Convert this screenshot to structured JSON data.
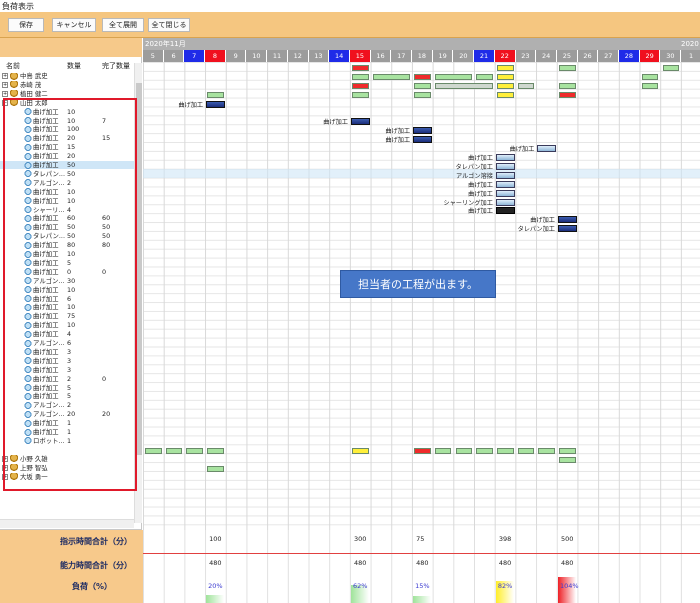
{
  "window_title": "負荷表示",
  "toolbar": {
    "save": "保存",
    "cancel": "キャンセル",
    "expand_all": "全て展開",
    "collapse_all": "全て閉じる"
  },
  "tree_header": {
    "name": "名前",
    "qty": "数量",
    "done_qty": "完了数量"
  },
  "tree_rows": [
    {
      "name": "中島 武史",
      "type": "person",
      "expander": "+",
      "qty": "",
      "done": ""
    },
    {
      "name": "赤崎 茂",
      "type": "person",
      "expander": "+",
      "qty": "",
      "done": ""
    },
    {
      "name": "植田 健二",
      "type": "person",
      "expander": "+",
      "qty": "",
      "done": ""
    },
    {
      "name": "山田 太郎",
      "type": "person",
      "expander": "−",
      "qty": "",
      "done": ""
    },
    {
      "name": "曲げ加工",
      "type": "task",
      "qty": "10",
      "done": ""
    },
    {
      "name": "曲げ加工",
      "type": "task",
      "qty": "10",
      "done": "7"
    },
    {
      "name": "曲げ加工",
      "type": "task",
      "qty": "100",
      "done": ""
    },
    {
      "name": "曲げ加工",
      "type": "task",
      "qty": "20",
      "done": "15"
    },
    {
      "name": "曲げ加工",
      "type": "task",
      "qty": "15",
      "done": ""
    },
    {
      "name": "曲げ加工",
      "type": "task",
      "qty": "20",
      "done": ""
    },
    {
      "name": "曲げ加工",
      "type": "task",
      "qty": "50",
      "done": "",
      "selected": true
    },
    {
      "name": "タレパン...",
      "type": "task",
      "qty": "50",
      "done": ""
    },
    {
      "name": "アルゴン...",
      "type": "task",
      "qty": "2",
      "done": ""
    },
    {
      "name": "曲げ加工",
      "type": "task",
      "qty": "10",
      "done": ""
    },
    {
      "name": "曲げ加工",
      "type": "task",
      "qty": "10",
      "done": ""
    },
    {
      "name": "シャーリ...",
      "type": "task",
      "qty": "4",
      "done": ""
    },
    {
      "name": "曲げ加工",
      "type": "task",
      "qty": "60",
      "done": "60"
    },
    {
      "name": "曲げ加工",
      "type": "task",
      "qty": "50",
      "done": "50"
    },
    {
      "name": "タレパン...",
      "type": "task",
      "qty": "50",
      "done": "50"
    },
    {
      "name": "曲げ加工",
      "type": "task",
      "qty": "80",
      "done": "80"
    },
    {
      "name": "曲げ加工",
      "type": "task",
      "qty": "10",
      "done": ""
    },
    {
      "name": "曲げ加工",
      "type": "task",
      "qty": "5",
      "done": ""
    },
    {
      "name": "曲げ加工",
      "type": "task",
      "qty": "0",
      "done": "0"
    },
    {
      "name": "アルゴン...",
      "type": "task",
      "qty": "30",
      "done": ""
    },
    {
      "name": "曲げ加工",
      "type": "task",
      "qty": "10",
      "done": ""
    },
    {
      "name": "曲げ加工",
      "type": "task",
      "qty": "6",
      "done": ""
    },
    {
      "name": "曲げ加工",
      "type": "task",
      "qty": "10",
      "done": ""
    },
    {
      "name": "曲げ加工",
      "type": "task",
      "qty": "75",
      "done": ""
    },
    {
      "name": "曲げ加工",
      "type": "task",
      "qty": "10",
      "done": ""
    },
    {
      "name": "曲げ加工",
      "type": "task",
      "qty": "4",
      "done": ""
    },
    {
      "name": "アルゴン...",
      "type": "task",
      "qty": "6",
      "done": ""
    },
    {
      "name": "曲げ加工",
      "type": "task",
      "qty": "3",
      "done": ""
    },
    {
      "name": "曲げ加工",
      "type": "task",
      "qty": "3",
      "done": ""
    },
    {
      "name": "曲げ加工",
      "type": "task",
      "qty": "3",
      "done": ""
    },
    {
      "name": "曲げ加工",
      "type": "task",
      "qty": "2",
      "done": "0"
    },
    {
      "name": "曲げ加工",
      "type": "task",
      "qty": "5",
      "done": ""
    },
    {
      "name": "曲げ加工",
      "type": "task",
      "qty": "5",
      "done": ""
    },
    {
      "name": "アルゴン...",
      "type": "task",
      "qty": "2",
      "done": ""
    },
    {
      "name": "アルゴン...",
      "type": "task",
      "qty": "20",
      "done": "20"
    },
    {
      "name": "曲げ加工",
      "type": "task",
      "qty": "1",
      "done": ""
    },
    {
      "name": "曲げ加工",
      "type": "task",
      "qty": "1",
      "done": ""
    },
    {
      "name": "ロボット...",
      "type": "task",
      "qty": "1",
      "done": ""
    },
    {
      "name": "",
      "type": "blank",
      "qty": "",
      "done": ""
    },
    {
      "name": "小野 久雄",
      "type": "person",
      "expander": "+",
      "qty": "",
      "done": ""
    },
    {
      "name": "上野 智弘",
      "type": "person",
      "expander": "+",
      "qty": "",
      "done": ""
    },
    {
      "name": "大坂 勇一",
      "type": "person",
      "expander": "+",
      "qty": "",
      "done": ""
    }
  ],
  "calendar": {
    "month_label": "2020年11月",
    "next_month_label": "2020",
    "days": [
      {
        "d": "5",
        "kind": "normal"
      },
      {
        "d": "6",
        "kind": "normal"
      },
      {
        "d": "7",
        "kind": "sat"
      },
      {
        "d": "8",
        "kind": "sun"
      },
      {
        "d": "9",
        "kind": "normal"
      },
      {
        "d": "10",
        "kind": "normal"
      },
      {
        "d": "11",
        "kind": "normal"
      },
      {
        "d": "12",
        "kind": "normal"
      },
      {
        "d": "13",
        "kind": "normal"
      },
      {
        "d": "14",
        "kind": "sat"
      },
      {
        "d": "15",
        "kind": "sun"
      },
      {
        "d": "16",
        "kind": "normal"
      },
      {
        "d": "17",
        "kind": "normal"
      },
      {
        "d": "18",
        "kind": "normal"
      },
      {
        "d": "19",
        "kind": "normal"
      },
      {
        "d": "20",
        "kind": "normal"
      },
      {
        "d": "21",
        "kind": "sat"
      },
      {
        "d": "22",
        "kind": "sun"
      },
      {
        "d": "23",
        "kind": "normal"
      },
      {
        "d": "24",
        "kind": "normal"
      },
      {
        "d": "25",
        "kind": "normal"
      },
      {
        "d": "26",
        "kind": "normal"
      },
      {
        "d": "27",
        "kind": "normal"
      },
      {
        "d": "28",
        "kind": "sat"
      },
      {
        "d": "29",
        "kind": "sun"
      },
      {
        "d": "30",
        "kind": "normal"
      },
      {
        "d": "1",
        "kind": "normal"
      }
    ],
    "colors": {
      "sat": "#1f2be8",
      "sun": "#f0101e",
      "normal": "#9c9c9c"
    }
  },
  "task_labels": [
    {
      "text": "曲げ加工",
      "row": 5,
      "col": 3
    },
    {
      "text": "曲げ加工",
      "row": 7,
      "col": 10
    },
    {
      "text": "曲げ加工",
      "row": 8,
      "col": 13
    },
    {
      "text": "曲げ加工",
      "row": 9,
      "col": 13
    },
    {
      "text": "曲げ加工",
      "row": 10,
      "col": 19
    },
    {
      "text": "曲げ加工",
      "row": 11,
      "col": 17
    },
    {
      "text": "タレパン加工",
      "row": 12,
      "col": 17
    },
    {
      "text": "アルゴン溶接",
      "row": 13,
      "col": 17
    },
    {
      "text": "曲げ加工",
      "row": 14,
      "col": 17
    },
    {
      "text": "曲げ加工",
      "row": 15,
      "col": 17
    },
    {
      "text": "シャーリング加工",
      "row": 16,
      "col": 17
    },
    {
      "text": "曲げ加工",
      "row": 17,
      "col": 17
    },
    {
      "text": "曲げ加工",
      "row": 18,
      "col": 20
    },
    {
      "text": "タレパン加工",
      "row": 19,
      "col": 20
    }
  ],
  "callout": "担当者の工程が出ます。",
  "footer": {
    "instructed_label": "指示時間合計（分）",
    "capacity_label": "能力時間合計（分）",
    "load_label": "負荷（%）",
    "instructed": [
      {
        "col": 3,
        "v": "100"
      },
      {
        "col": 10,
        "v": "300"
      },
      {
        "col": 13,
        "v": "75"
      },
      {
        "col": 17,
        "v": "398"
      },
      {
        "col": 20,
        "v": "500"
      }
    ],
    "capacity": [
      {
        "col": 3,
        "v": "480"
      },
      {
        "col": 10,
        "v": "480"
      },
      {
        "col": 13,
        "v": "480"
      },
      {
        "col": 17,
        "v": "480"
      },
      {
        "col": 20,
        "v": "480"
      }
    ],
    "load": [
      {
        "col": 3,
        "v": "20%",
        "level": 0.2,
        "color": "#9fe39a"
      },
      {
        "col": 10,
        "v": "62%",
        "level": 0.62,
        "color": "#9fe39a"
      },
      {
        "col": 13,
        "v": "15%",
        "level": 0.15,
        "color": "#9fe39a"
      },
      {
        "col": 17,
        "v": "82%",
        "level": 0.82,
        "color": "#ffee2a"
      },
      {
        "col": 20,
        "v": "104%",
        "level": 1.0,
        "color": "#ee1f25"
      }
    ]
  }
}
